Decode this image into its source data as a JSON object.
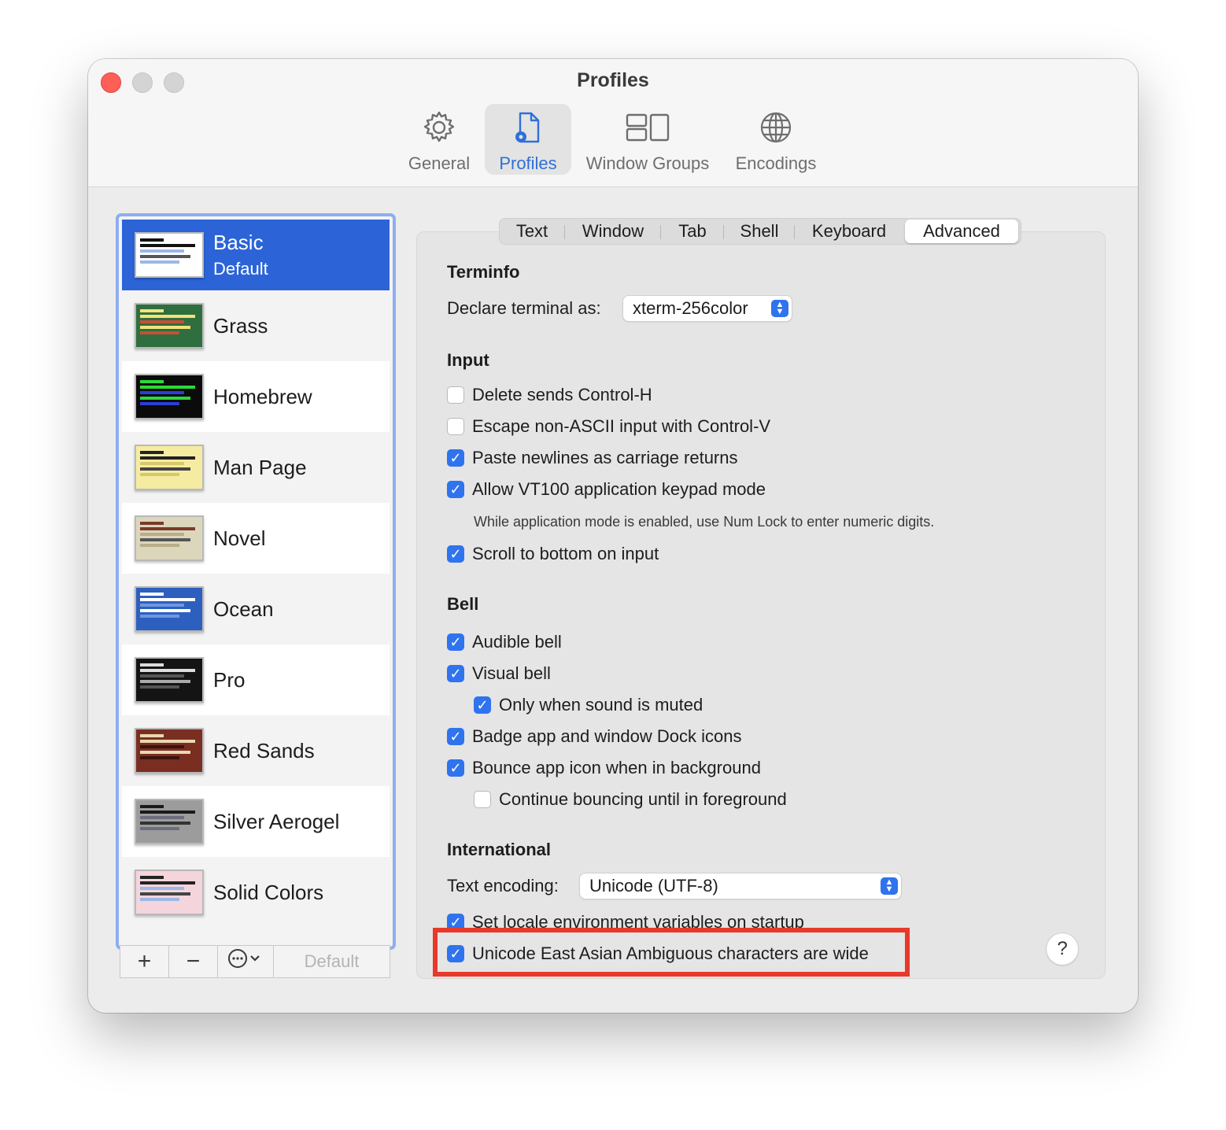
{
  "window": {
    "title": "Profiles"
  },
  "toolbar": {
    "items": [
      {
        "label": "General",
        "icon": "gear-icon",
        "selected": false
      },
      {
        "label": "Profiles",
        "icon": "profile-document-icon",
        "selected": true
      },
      {
        "label": "Window Groups",
        "icon": "window-groups-icon",
        "selected": false
      },
      {
        "label": "Encodings",
        "icon": "globe-icon",
        "selected": false
      }
    ]
  },
  "colors": {
    "accent": "#2c64d8",
    "checkbox": "#2f73ee",
    "highlight": "#e8392a"
  },
  "sidebar": {
    "profiles": [
      {
        "name": "Basic",
        "subtitle": "Default",
        "selected": true,
        "bg": "#ffffff",
        "fg": "#111111"
      },
      {
        "name": "Grass",
        "selected": false,
        "bg": "#2f6e3e",
        "fg": "#f3e27a"
      },
      {
        "name": "Homebrew",
        "selected": false,
        "bg": "#0b0b0b",
        "fg": "#2bd93a"
      },
      {
        "name": "Man Page",
        "selected": false,
        "bg": "#f5eca1",
        "fg": "#222222"
      },
      {
        "name": "Novel",
        "selected": false,
        "bg": "#dcd6bc",
        "fg": "#7a3b2a"
      },
      {
        "name": "Ocean",
        "selected": false,
        "bg": "#2d5fbf",
        "fg": "#ffffff"
      },
      {
        "name": "Pro",
        "selected": false,
        "bg": "#141414",
        "fg": "#dddddd"
      },
      {
        "name": "Red Sands",
        "selected": false,
        "bg": "#7a2e22",
        "fg": "#e8d9b0"
      },
      {
        "name": "Silver Aerogel",
        "selected": false,
        "bg": "#9c9c9c",
        "fg": "#1a1a1a"
      },
      {
        "name": "Solid Colors",
        "selected": false,
        "bg": "#f4d5db",
        "fg": "#222222"
      }
    ],
    "controls": {
      "add": "+",
      "remove": "−",
      "more_icon": "ellipsis-circle-icon",
      "default_label": "Default"
    }
  },
  "tabs": [
    "Text",
    "Window",
    "Tab",
    "Shell",
    "Keyboard",
    "Advanced"
  ],
  "active_tab": "Advanced",
  "advanced": {
    "terminfo": {
      "title": "Terminfo",
      "declare_label": "Declare terminal as:",
      "declare_value": "xterm-256color"
    },
    "input": {
      "title": "Input",
      "delete_sends_ctrl_h": {
        "label": "Delete sends Control-H",
        "checked": false
      },
      "escape_non_ascii": {
        "label": "Escape non-ASCII input with Control-V",
        "checked": false
      },
      "paste_newlines": {
        "label": "Paste newlines as carriage returns",
        "checked": true
      },
      "allow_vt100": {
        "label": "Allow VT100 application keypad mode",
        "checked": true
      },
      "vt100_note": "While application mode is enabled, use Num Lock to enter numeric digits.",
      "scroll_bottom": {
        "label": "Scroll to bottom on input",
        "checked": true
      }
    },
    "bell": {
      "title": "Bell",
      "audible": {
        "label": "Audible bell",
        "checked": true
      },
      "visual": {
        "label": "Visual bell",
        "checked": true
      },
      "only_muted": {
        "label": "Only when sound is muted",
        "checked": true
      },
      "badge": {
        "label": "Badge app and window Dock icons",
        "checked": true
      },
      "bounce": {
        "label": "Bounce app icon when in background",
        "checked": true
      },
      "continue_bouncing": {
        "label": "Continue bouncing until in foreground",
        "checked": false
      }
    },
    "international": {
      "title": "International",
      "encoding_label": "Text encoding:",
      "encoding_value": "Unicode (UTF-8)",
      "set_locale": {
        "label": "Set locale environment variables on startup",
        "checked": true
      },
      "east_asian_wide": {
        "label": "Unicode East Asian Ambiguous characters are wide",
        "checked": true
      }
    },
    "help_label": "?"
  }
}
